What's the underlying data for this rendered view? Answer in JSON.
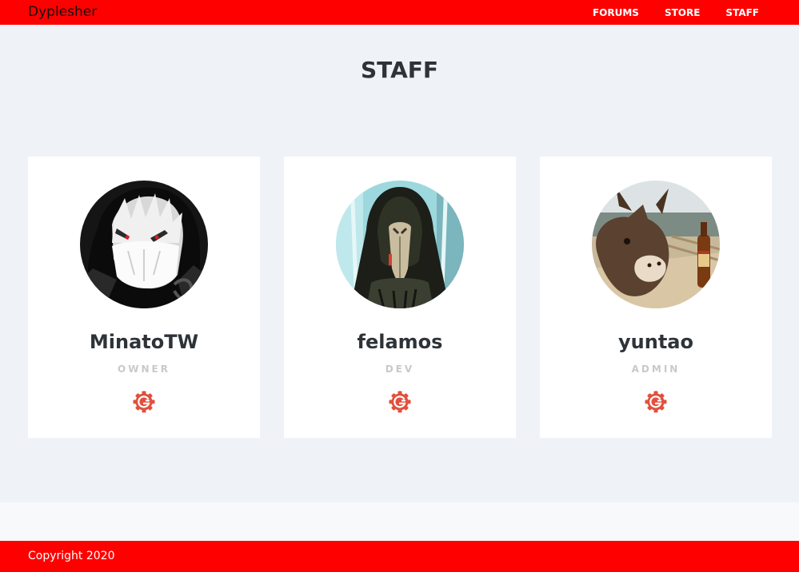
{
  "nav": {
    "brand": "Dyplesher",
    "links": [
      {
        "label": "FORUMS"
      },
      {
        "label": "STORE"
      },
      {
        "label": "STAFF"
      }
    ]
  },
  "main": {
    "title": "STAFF",
    "staff": [
      {
        "name": "MinatoTW",
        "role": "OWNER",
        "profile_icon": "gitea-icon"
      },
      {
        "name": "felamos",
        "role": "DEV",
        "profile_icon": "gitea-icon"
      },
      {
        "name": "yuntao",
        "role": "ADMIN",
        "profile_icon": "gitea-icon"
      }
    ]
  },
  "footer": {
    "copyright": "Copyright 2020"
  },
  "colors": {
    "accent": "#ff0000",
    "page_background": "#eff3f7",
    "card_background": "#ffffff",
    "heading": "#2e3338",
    "role_text": "#c9c9c9",
    "profile_icon": "#e0513d"
  }
}
